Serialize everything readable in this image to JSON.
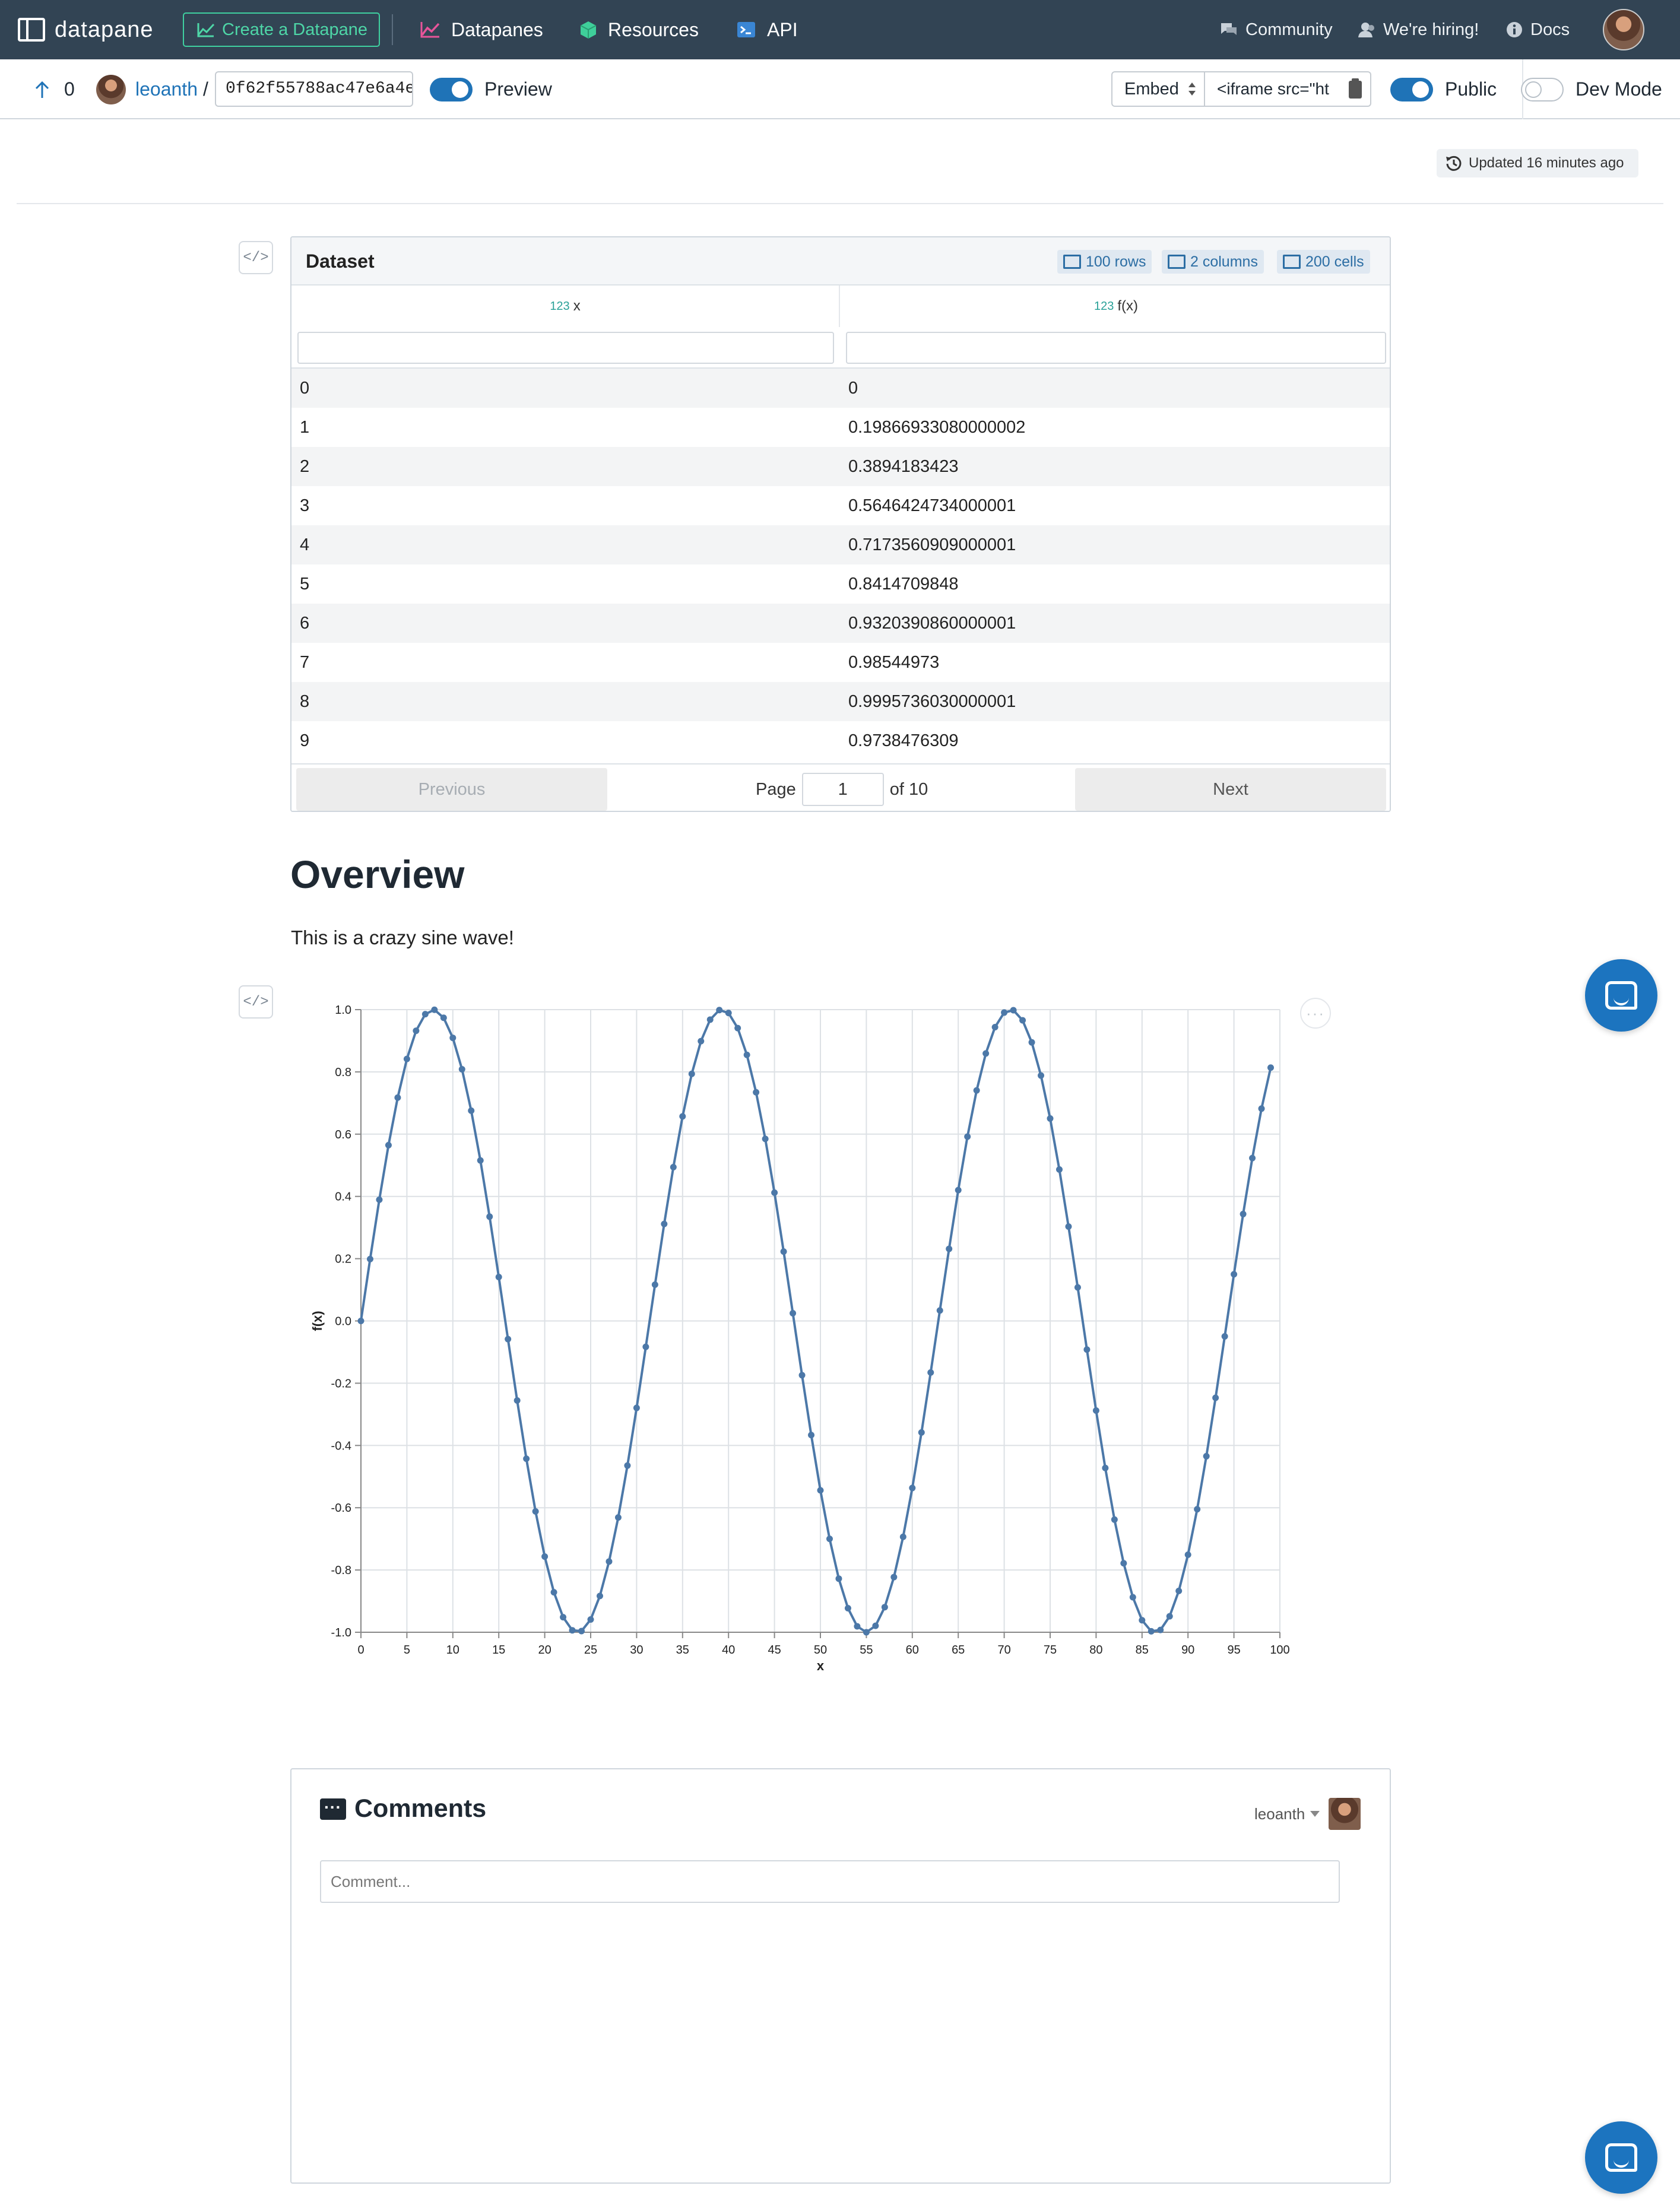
{
  "nav": {
    "logo_text": "datapane",
    "create_button": "Create a Datapane",
    "links": [
      {
        "label": "Datapanes",
        "icon": "chart-icon"
      },
      {
        "label": "Resources",
        "icon": "box-icon"
      },
      {
        "label": "API",
        "icon": "terminal-icon"
      }
    ],
    "right_links": [
      {
        "label": "Community",
        "icon": "chat-icon"
      },
      {
        "label": "We're hiring!",
        "icon": "user-icon"
      },
      {
        "label": "Docs",
        "icon": "info-icon"
      }
    ]
  },
  "subbar": {
    "vote_count": "0",
    "username": "leoanth",
    "separator": "/",
    "slug": "0f62f55788ac47e6a4e",
    "preview_label": "Preview",
    "embed_label": "Embed",
    "embed_code": "<iframe src=\"ht",
    "public_label": "Public",
    "devmode_label": "Dev Mode"
  },
  "updated": "Updated 16 minutes ago",
  "code_toggle": "</>",
  "dataset": {
    "title": "Dataset",
    "badges": [
      "100 rows",
      "2 columns",
      "200 cells"
    ],
    "type_tag": "123",
    "columns": [
      "x",
      "f(x)"
    ],
    "rows": [
      [
        "0",
        "0"
      ],
      [
        "1",
        "0.19866933080000002"
      ],
      [
        "2",
        "0.3894183423"
      ],
      [
        "3",
        "0.5646424734000001"
      ],
      [
        "4",
        "0.7173560909000001"
      ],
      [
        "5",
        "0.8414709848"
      ],
      [
        "6",
        "0.9320390860000001"
      ],
      [
        "7",
        "0.98544973"
      ],
      [
        "8",
        "0.9995736030000001"
      ],
      [
        "9",
        "0.9738476309"
      ]
    ],
    "pager": {
      "previous": "Previous",
      "next": "Next",
      "page_label": "Page",
      "page": "1",
      "of_label": "of 10"
    }
  },
  "overview": {
    "title": "Overview",
    "text": "This is a crazy sine wave!"
  },
  "chart_menu": "···",
  "chart_data": {
    "type": "line",
    "xlabel": "x",
    "ylabel": "f(x)",
    "xlim": [
      0,
      100
    ],
    "ylim": [
      -1.0,
      1.0
    ],
    "x_ticks": [
      0,
      5,
      10,
      15,
      20,
      25,
      30,
      35,
      40,
      45,
      50,
      55,
      60,
      65,
      70,
      75,
      80,
      85,
      90,
      95,
      100
    ],
    "y_ticks": [
      "1.0",
      "0.8",
      "0.6",
      "0.4",
      "0.2",
      "0.0",
      "-0.2",
      "-0.4",
      "-0.6",
      "-0.8",
      "-1.0"
    ],
    "series": [
      {
        "function": "sin(x/5)",
        "x_start": 0,
        "x_end": 99,
        "x_step": 1
      }
    ],
    "grid": true,
    "color": "#4c78a8"
  },
  "comments": {
    "title": "Comments",
    "user": "leoanth",
    "placeholder": "Comment..."
  }
}
